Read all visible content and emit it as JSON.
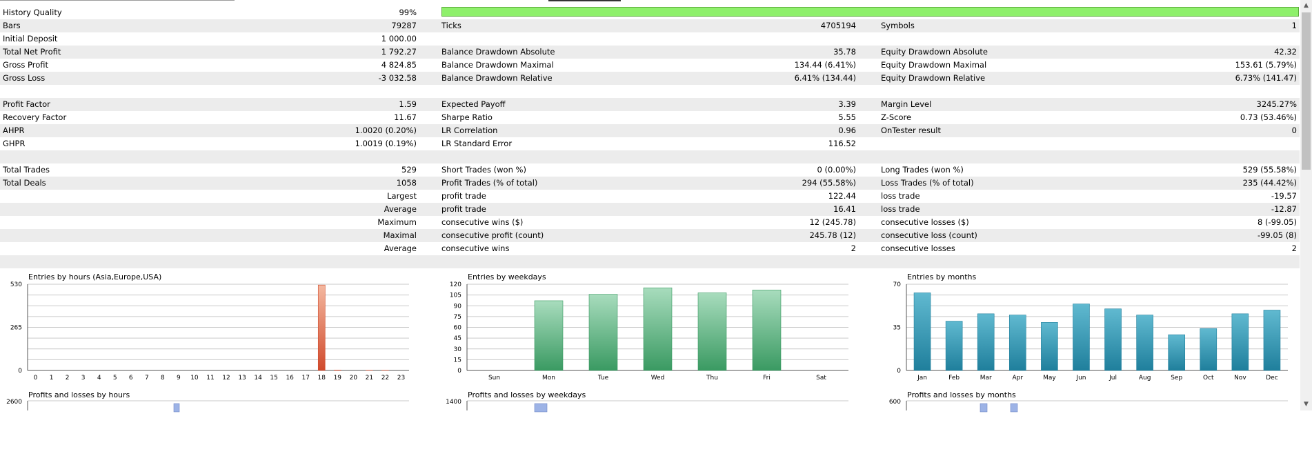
{
  "history_quality": {
    "label": "History Quality",
    "value": "99%",
    "fraction": 0.99
  },
  "rows": [
    {
      "l": "Bars",
      "v1": "79287",
      "m": "Ticks",
      "v2": "4705194",
      "r": "Symbols",
      "v3": "1"
    },
    {
      "l": "Initial Deposit",
      "v1": "1 000.00",
      "m": "",
      "v2": "",
      "r": "",
      "v3": ""
    },
    {
      "l": "Total Net Profit",
      "v1": "1 792.27",
      "m": "Balance Drawdown Absolute",
      "v2": "35.78",
      "r": "Equity Drawdown Absolute",
      "v3": "42.32"
    },
    {
      "l": "Gross Profit",
      "v1": "4 824.85",
      "m": "Balance Drawdown Maximal",
      "v2": "134.44 (6.41%)",
      "r": "Equity Drawdown Maximal",
      "v3": "153.61 (5.79%)"
    },
    {
      "l": "Gross Loss",
      "v1": "-3 032.58",
      "m": "Balance Drawdown Relative",
      "v2": "6.41% (134.44)",
      "r": "Equity Drawdown Relative",
      "v3": "6.73% (141.47)"
    },
    {
      "l": "",
      "v1": "",
      "m": "",
      "v2": "",
      "r": "",
      "v3": ""
    },
    {
      "l": "Profit Factor",
      "v1": "1.59",
      "m": "Expected Payoff",
      "v2": "3.39",
      "r": "Margin Level",
      "v3": "3245.27%"
    },
    {
      "l": "Recovery Factor",
      "v1": "11.67",
      "m": "Sharpe Ratio",
      "v2": "5.55",
      "r": "Z-Score",
      "v3": "0.73 (53.46%)"
    },
    {
      "l": "AHPR",
      "v1": "1.0020 (0.20%)",
      "m": "LR Correlation",
      "v2": "0.96",
      "r": "OnTester result",
      "v3": "0"
    },
    {
      "l": "GHPR",
      "v1": "1.0019 (0.19%)",
      "m": "LR Standard Error",
      "v2": "116.52",
      "r": "",
      "v3": ""
    },
    {
      "l": "",
      "v1": "",
      "m": "",
      "v2": "",
      "r": "",
      "v3": ""
    },
    {
      "l": "Total Trades",
      "v1": "529",
      "m": "Short Trades (won %)",
      "v2": "0 (0.00%)",
      "r": "Long Trades (won %)",
      "v3": "529 (55.58%)"
    },
    {
      "l": "Total Deals",
      "v1": "1058",
      "m": "Profit Trades (% of total)",
      "v2": "294 (55.58%)",
      "r": "Loss Trades (% of total)",
      "v3": "235 (44.42%)"
    },
    {
      "l": "",
      "v1": "Largest",
      "m": "profit trade",
      "v2": "122.44",
      "r": "loss trade",
      "v3": "-19.57"
    },
    {
      "l": "",
      "v1": "Average",
      "m": "profit trade",
      "v2": "16.41",
      "r": "loss trade",
      "v3": "-12.87"
    },
    {
      "l": "",
      "v1": "Maximum",
      "m": "consecutive wins ($)",
      "v2": "12 (245.78)",
      "r": "consecutive losses ($)",
      "v3": "8 (-99.05)"
    },
    {
      "l": "",
      "v1": "Maximal",
      "m": "consecutive profit (count)",
      "v2": "245.78 (12)",
      "r": "consecutive loss (count)",
      "v3": "-99.05 (8)"
    },
    {
      "l": "",
      "v1": "Average",
      "m": "consecutive wins",
      "v2": "2",
      "r": "consecutive losses",
      "v3": "2"
    },
    {
      "l": "",
      "v1": "",
      "m": "",
      "v2": "",
      "r": "",
      "v3": ""
    }
  ],
  "chart_data": [
    {
      "type": "bar",
      "title": "Entries by hours (Asia,Europe,USA)",
      "categories": [
        "0",
        "1",
        "2",
        "3",
        "4",
        "5",
        "6",
        "7",
        "8",
        "9",
        "10",
        "11",
        "12",
        "13",
        "14",
        "15",
        "16",
        "17",
        "18",
        "19",
        "20",
        "21",
        "22",
        "23"
      ],
      "values": [
        0,
        0,
        0,
        0,
        0,
        0,
        0,
        0,
        0,
        0,
        0,
        0,
        0,
        0,
        0,
        0,
        0,
        0,
        525,
        2,
        0,
        1,
        1,
        0
      ],
      "yticks": [
        "530",
        "265",
        "0"
      ],
      "ylim": [
        0,
        530
      ],
      "color": "#d04a2c"
    },
    {
      "type": "bar",
      "title": "Entries by weekdays",
      "categories": [
        "Sun",
        "Mon",
        "Tue",
        "Wed",
        "Thu",
        "Fri",
        "Sat"
      ],
      "values": [
        0,
        97,
        106,
        115,
        108,
        112,
        0
      ],
      "yticks": [
        "120",
        "105",
        "90",
        "75",
        "60",
        "45",
        "30",
        "15",
        "0"
      ],
      "ylim": [
        0,
        120
      ],
      "color": "#3a9a62"
    },
    {
      "type": "bar",
      "title": "Entries by months",
      "categories": [
        "Jan",
        "Feb",
        "Mar",
        "Apr",
        "May",
        "Jun",
        "Jul",
        "Aug",
        "Sep",
        "Oct",
        "Nov",
        "Dec"
      ],
      "values": [
        63,
        40,
        46,
        45,
        39,
        54,
        50,
        45,
        29,
        34,
        46,
        49
      ],
      "yticks": [
        "70",
        "35",
        "0"
      ],
      "ylim": [
        0,
        70
      ],
      "color": "#1f7f9c"
    },
    {
      "type": "bar",
      "title": "Profits and losses by hours",
      "yticks": [
        "2600"
      ],
      "ylim": [
        0,
        2600
      ],
      "color": "#8aa6e0"
    },
    {
      "type": "bar",
      "title": "Profits and losses by weekdays",
      "yticks": [
        "1400"
      ],
      "ylim": [
        0,
        1400
      ],
      "color": "#8aa6e0"
    },
    {
      "type": "bar",
      "title": "Profits and losses by months",
      "yticks": [
        "600"
      ],
      "ylim": [
        0,
        600
      ],
      "color": "#8aa6e0"
    }
  ],
  "scrollbar": {
    "up": "▲",
    "down": "▼"
  }
}
